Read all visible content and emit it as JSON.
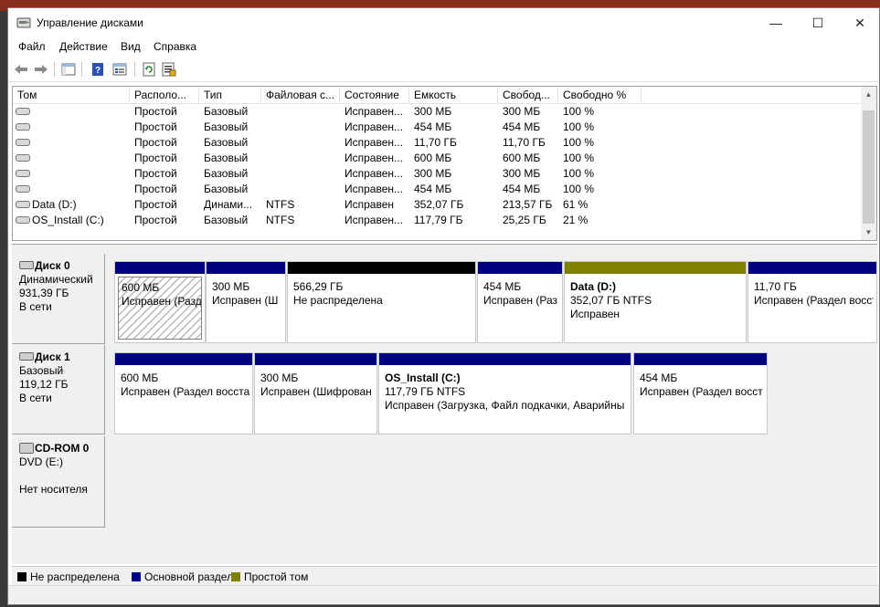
{
  "window": {
    "title": "Управление дисками",
    "minimize": "—",
    "maximize": "☐",
    "close": "✕"
  },
  "menu": [
    "Файл",
    "Действие",
    "Вид",
    "Справка"
  ],
  "toolbar": {
    "icons": [
      "back-icon",
      "forward-icon",
      "console-tree-icon",
      "help-icon",
      "properties-icon",
      "refresh-icon",
      "export-list-icon"
    ]
  },
  "volume_list": {
    "columns": [
      "Том",
      "Располо...",
      "Тип",
      "Файловая с...",
      "Состояние",
      "Емкость",
      "Свобод...",
      "Свободно %"
    ],
    "rows": [
      {
        "name": "",
        "layout": "Простой",
        "type": "Базовый",
        "fs": "",
        "status": "Исправен...",
        "capacity": "300 МБ",
        "free": "300 МБ",
        "free_pct": "100 %"
      },
      {
        "name": "",
        "layout": "Простой",
        "type": "Базовый",
        "fs": "",
        "status": "Исправен...",
        "capacity": "454 МБ",
        "free": "454 МБ",
        "free_pct": "100 %"
      },
      {
        "name": "",
        "layout": "Простой",
        "type": "Базовый",
        "fs": "",
        "status": "Исправен...",
        "capacity": "11,70 ГБ",
        "free": "11,70 ГБ",
        "free_pct": "100 %"
      },
      {
        "name": "",
        "layout": "Простой",
        "type": "Базовый",
        "fs": "",
        "status": "Исправен...",
        "capacity": "600 МБ",
        "free": "600 МБ",
        "free_pct": "100 %"
      },
      {
        "name": "",
        "layout": "Простой",
        "type": "Базовый",
        "fs": "",
        "status": "Исправен...",
        "capacity": "300 МБ",
        "free": "300 МБ",
        "free_pct": "100 %"
      },
      {
        "name": "",
        "layout": "Простой",
        "type": "Базовый",
        "fs": "",
        "status": "Исправен...",
        "capacity": "454 МБ",
        "free": "454 МБ",
        "free_pct": "100 %"
      },
      {
        "name": "Data (D:)",
        "layout": "Простой",
        "type": "Динами...",
        "fs": "NTFS",
        "status": "Исправен",
        "capacity": "352,07 ГБ",
        "free": "213,57 ГБ",
        "free_pct": "61 %"
      },
      {
        "name": "OS_Install (C:)",
        "layout": "Простой",
        "type": "Базовый",
        "fs": "NTFS",
        "status": "Исправен...",
        "capacity": "117,79 ГБ",
        "free": "25,25 ГБ",
        "free_pct": "21 %"
      }
    ]
  },
  "disks": [
    {
      "name": "Диск 0",
      "kind": "Динамический",
      "size": "931,39 ГБ",
      "state": "В сети",
      "partitions": [
        {
          "band": "primary",
          "line1": "600 МБ",
          "line2": "Исправен (Разд",
          "hatched": true
        },
        {
          "band": "primary",
          "line1": "300 МБ",
          "line2": "Исправен (Ш"
        },
        {
          "band": "unallocated",
          "line1": "566,29 ГБ",
          "line2": "Не распределена"
        },
        {
          "band": "primary",
          "line1": "454 МБ",
          "line2": "Исправен (Раз"
        },
        {
          "band": "simple",
          "title": "Data  (D:)",
          "line1": "352,07 ГБ NTFS",
          "line2": "Исправен"
        },
        {
          "band": "primary",
          "line1": "11,70 ГБ",
          "line2": "Исправен (Раздел восста"
        }
      ]
    },
    {
      "name": "Диск 1",
      "kind": "Базовый",
      "size": "119,12 ГБ",
      "state": "В сети",
      "partitions": [
        {
          "band": "primary",
          "line1": "600 МБ",
          "line2": "Исправен (Раздел восста"
        },
        {
          "band": "primary",
          "line1": "300 МБ",
          "line2": "Исправен (Шифрован"
        },
        {
          "band": "primary",
          "title": "OS_Install  (C:)",
          "line1": "117,79 ГБ NTFS",
          "line2": "Исправен (Загрузка, Файл подкачки, Аварийны"
        },
        {
          "band": "primary",
          "line1": "454 МБ",
          "line2": "Исправен (Раздел восст"
        }
      ]
    },
    {
      "name": "CD-ROM 0",
      "kind": "DVD (E:)",
      "size": "",
      "state": "Нет носителя",
      "partitions": []
    }
  ],
  "legend": [
    {
      "label": "Не распределена",
      "color": "#000000"
    },
    {
      "label": "Основной раздел",
      "color": "#00007f"
    },
    {
      "label": "Простой том",
      "color": "#7f7f00"
    }
  ],
  "colors": {
    "primary": "#00007f",
    "unallocated": "#000000",
    "simple": "#7f7f00"
  }
}
